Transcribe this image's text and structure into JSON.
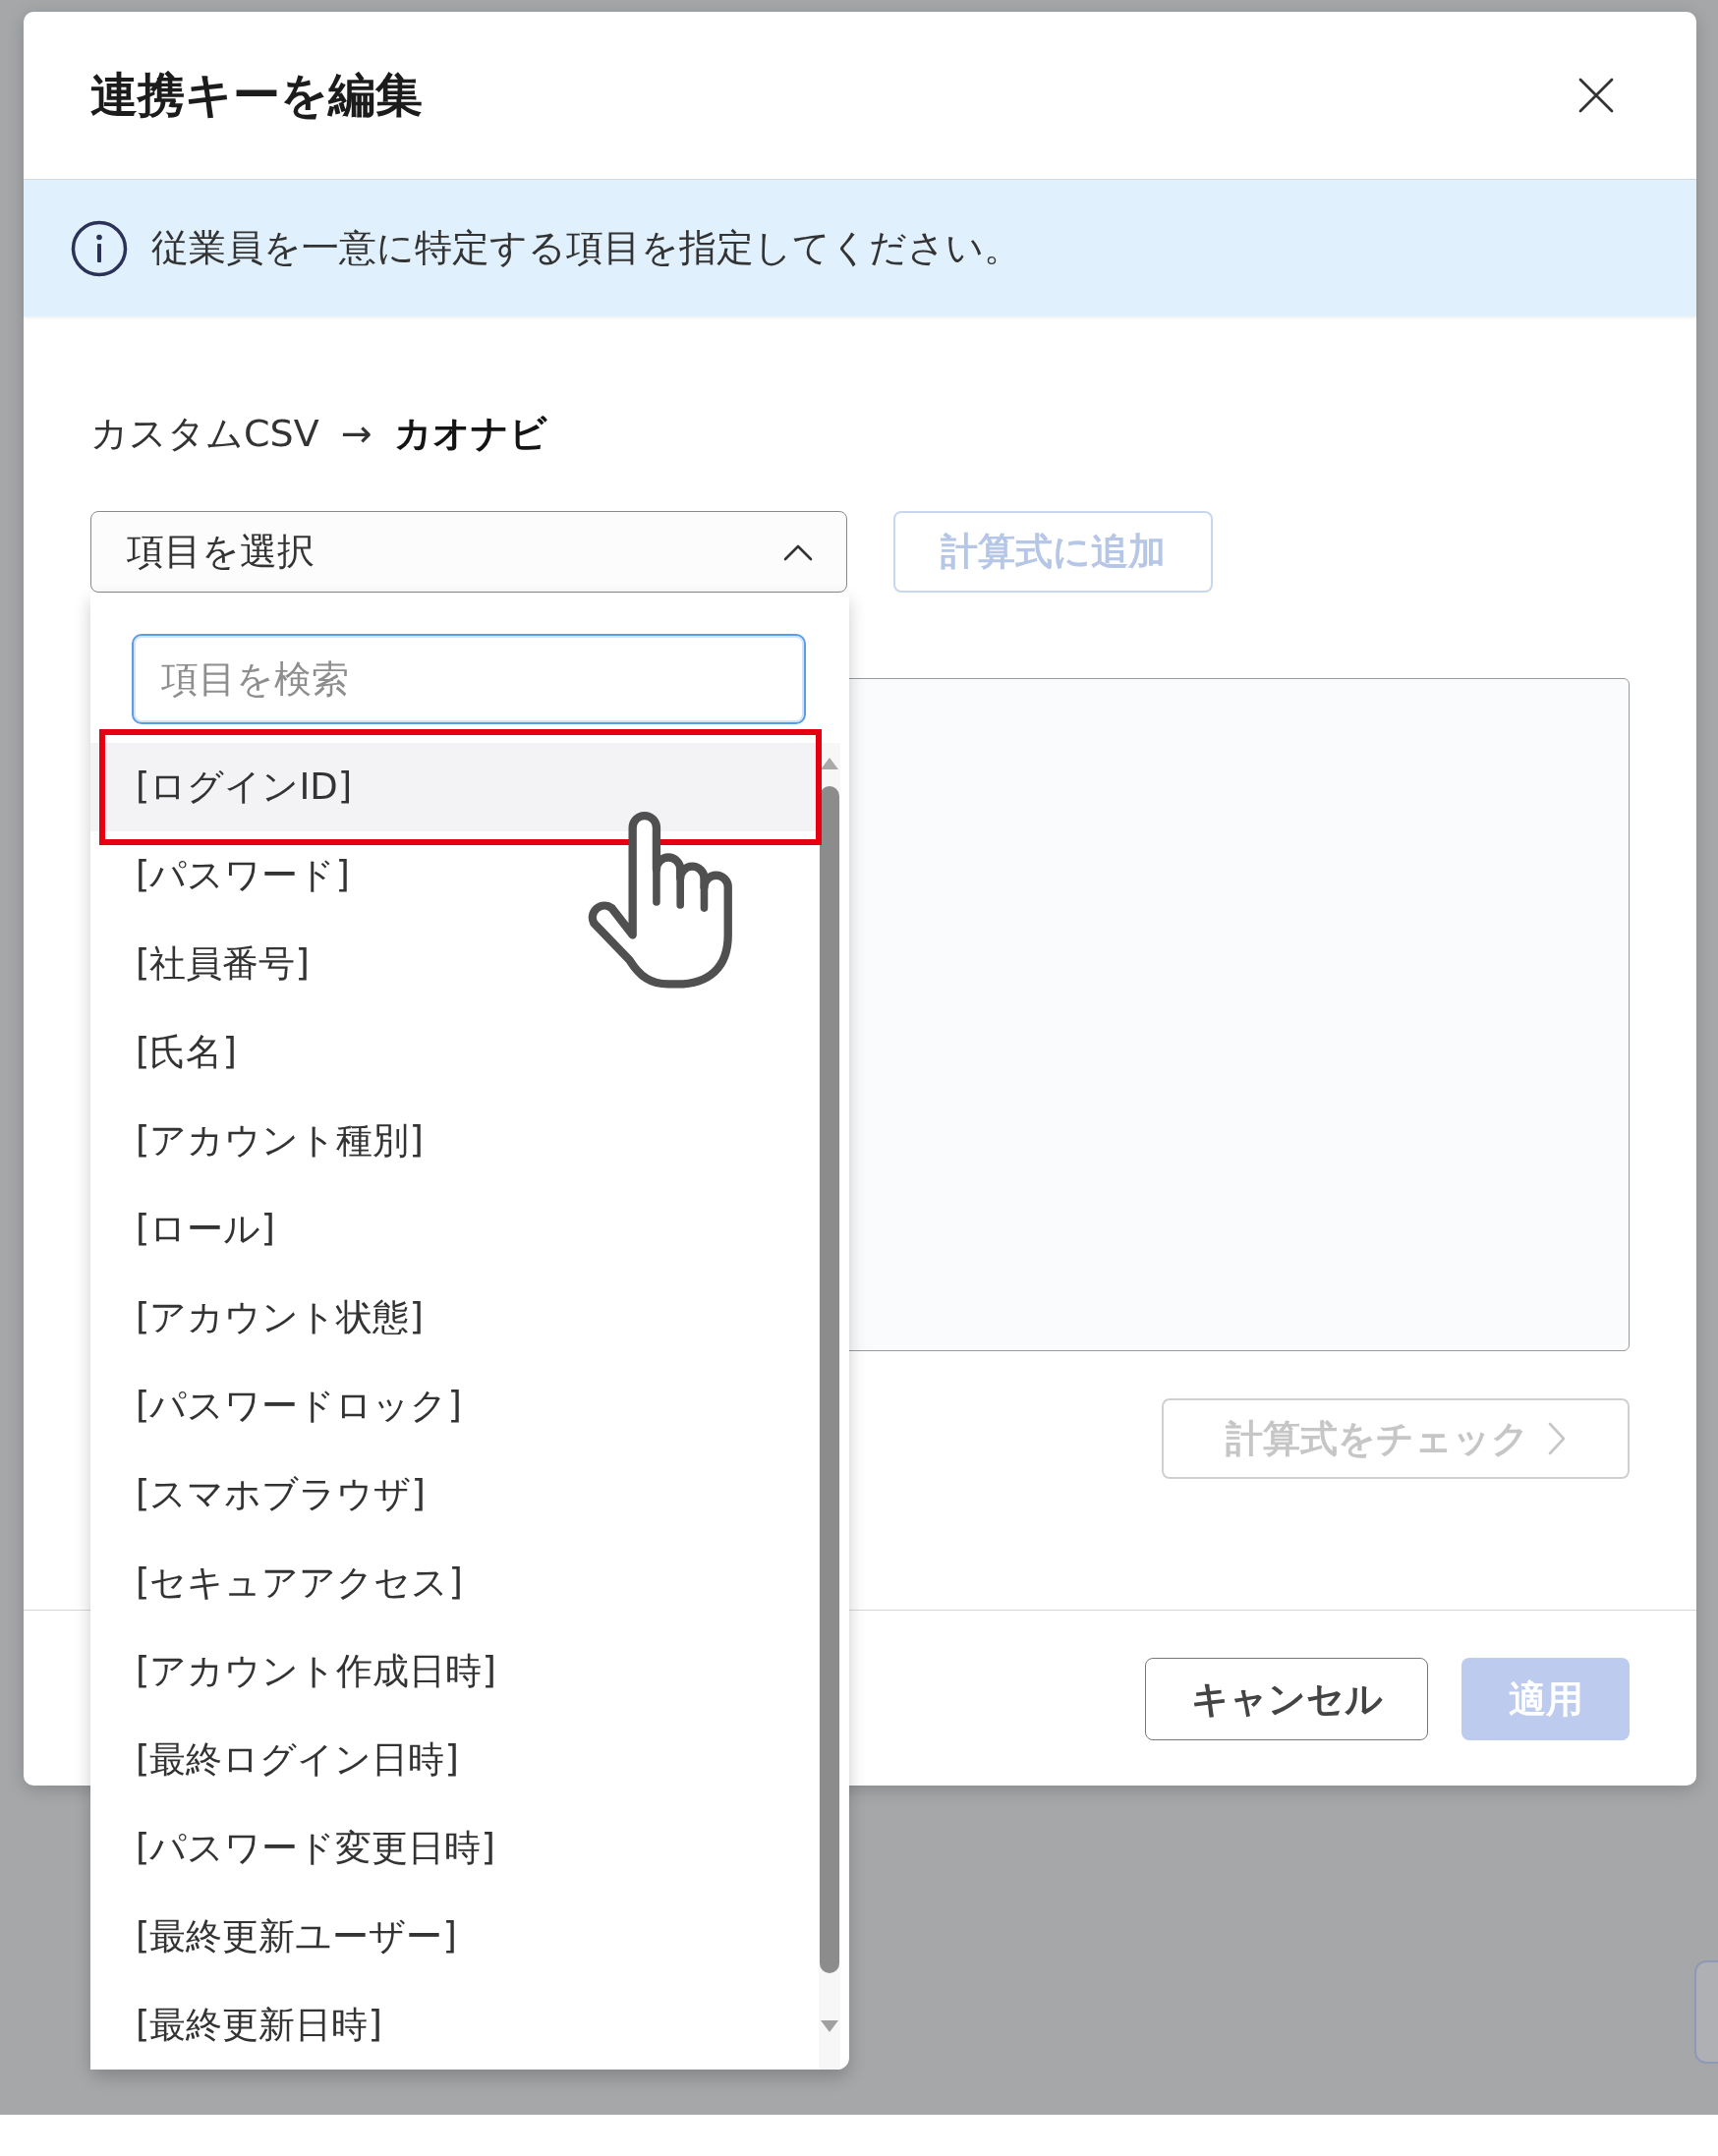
{
  "dialog": {
    "title": "連携キーを編集"
  },
  "notice": {
    "kind": "info",
    "text": "従業員を一意に特定する項目を指定してください。"
  },
  "mapping": {
    "source": "カスタムCSV",
    "arrow": "→",
    "target": "カオナビ"
  },
  "field_select": {
    "value": "項目を選択",
    "expanded": true
  },
  "add_button": {
    "label": "計算式に追加",
    "disabled": true
  },
  "dropdown": {
    "search": {
      "placeholder": "項目を検索"
    },
    "items": [
      {
        "label": "[ログインID]",
        "hovered": true,
        "framed": true
      },
      {
        "label": "[パスワード]",
        "hovered": false,
        "framed": false
      },
      {
        "label": "[社員番号]",
        "hovered": false,
        "framed": false
      },
      {
        "label": "[氏名]",
        "hovered": false,
        "framed": false
      },
      {
        "label": "[アカウント種別]",
        "hovered": false,
        "framed": false
      },
      {
        "label": "[ロール]",
        "hovered": false,
        "framed": false
      },
      {
        "label": "[アカウント状態]",
        "hovered": false,
        "framed": false
      },
      {
        "label": "[パスワードロック]",
        "hovered": false,
        "framed": false
      },
      {
        "label": "[スマホブラウザ]",
        "hovered": false,
        "framed": false
      },
      {
        "label": "[セキュアアクセス]",
        "hovered": false,
        "framed": false
      },
      {
        "label": "[アカウント作成日時]",
        "hovered": false,
        "framed": false
      },
      {
        "label": "[最終ログイン日時]",
        "hovered": false,
        "framed": false
      },
      {
        "label": "[パスワード変更日時]",
        "hovered": false,
        "framed": false
      },
      {
        "label": "[最終更新ユーザー]",
        "hovered": false,
        "framed": false
      },
      {
        "label": "[最終更新日時]",
        "hovered": false,
        "framed": false
      }
    ]
  },
  "check_button": {
    "label": "計算式をチェック",
    "disabled": true
  },
  "footer_buttons": [
    {
      "label": "キャンセル",
      "kind": "secondary",
      "disabled": false
    },
    {
      "label": "適用",
      "kind": "primary",
      "disabled": true
    }
  ]
}
